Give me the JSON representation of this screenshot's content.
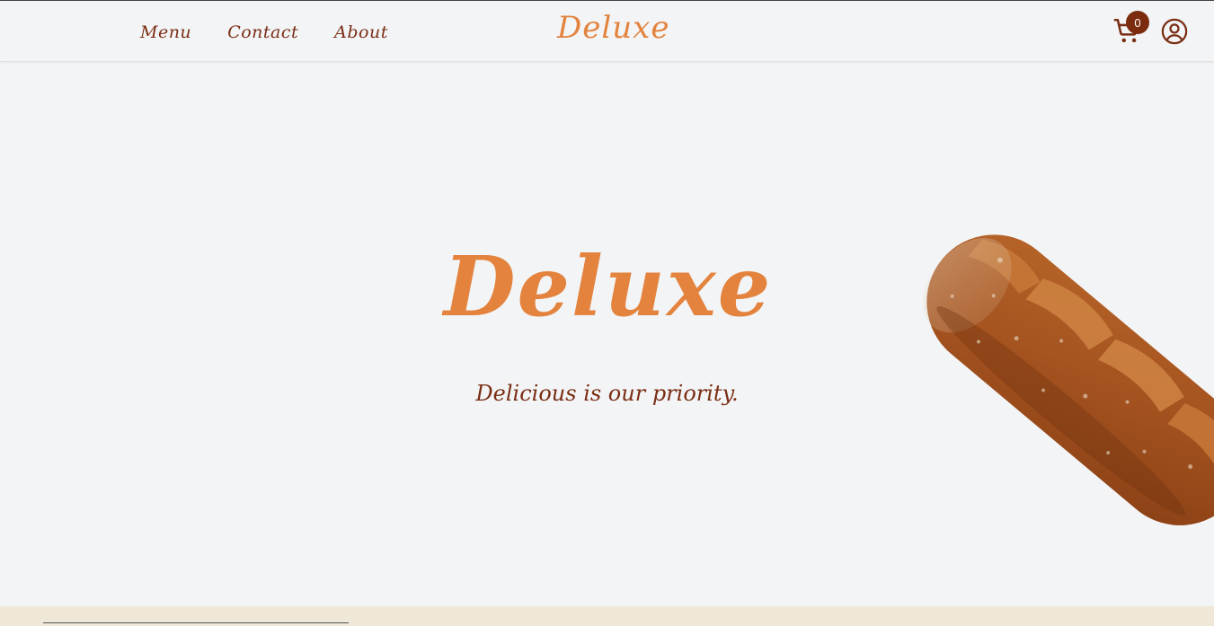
{
  "nav": {
    "links": [
      {
        "label": "Menu"
      },
      {
        "label": "Contact"
      },
      {
        "label": "About"
      }
    ],
    "brand": "Deluxe",
    "cart_icon": "cart-icon",
    "cart_count": "0",
    "user_icon": "user-circle-icon"
  },
  "hero": {
    "title": "Deluxe",
    "tagline": "Delicious is our priority.",
    "image": "baguette-bread"
  },
  "colors": {
    "accent": "#e3833e",
    "brown": "#7a2e14",
    "badge": "#7b2c0f",
    "background": "#f3f4f6",
    "footer": "#efe7d8"
  }
}
